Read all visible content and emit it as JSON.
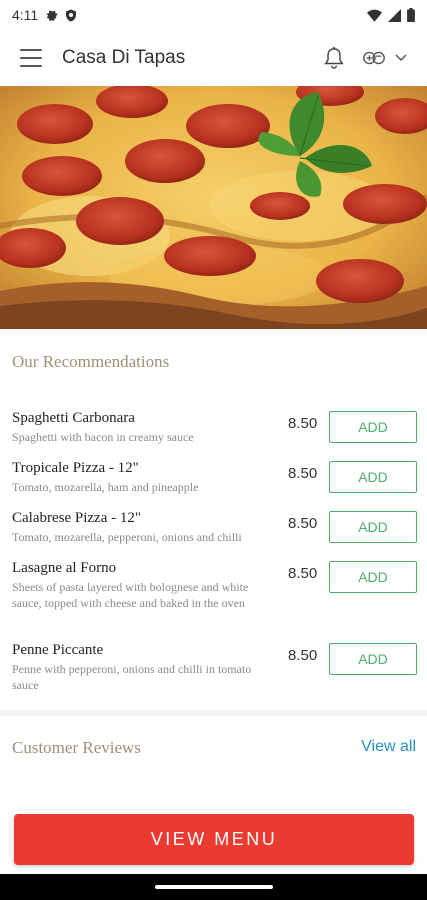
{
  "status_bar": {
    "time": "4:11",
    "icons": [
      "gear-icon",
      "shield-icon",
      "wifi-icon",
      "signal-icon",
      "battery-icon"
    ]
  },
  "app_bar": {
    "title": "Casa Di Tapas",
    "icons": [
      "menu-icon",
      "bell-icon",
      "language-icon",
      "chevron-down-icon"
    ]
  },
  "hero": {
    "description": "pizza-image"
  },
  "recommendations": {
    "title": "Our Recommendations",
    "add_label": "ADD",
    "items": [
      {
        "name": "Spaghetti Carbonara",
        "desc": "Spaghetti with bacon in creamy sauce",
        "price": "8.50"
      },
      {
        "name": "Tropicale Pizza - 12\"",
        "desc": "Tomato, mozarella, ham and pineapple",
        "price": "8.50"
      },
      {
        "name": "Calabrese Pizza - 12\"",
        "desc": "Tomato, mozarella, pepperoni, onions and chilli",
        "price": "8.50"
      },
      {
        "name": "Lasagne al Forno",
        "desc": "Sheets of pasta layered with bolognese and white sauce, topped with cheese and baked in the oven",
        "price": "8.50"
      },
      {
        "name": "Penne Piccante",
        "desc": "Penne with pepperoni, onions and chilli in tomato sauce",
        "price": "8.50"
      }
    ]
  },
  "reviews": {
    "title": "Customer Reviews",
    "view_all": "View all"
  },
  "cta": {
    "label": "VIEW MENU"
  },
  "colors": {
    "accent_red": "#ed3a30",
    "add_green": "#4caf6a",
    "section_title": "#9c9275",
    "link_blue": "#2a8fc1"
  }
}
